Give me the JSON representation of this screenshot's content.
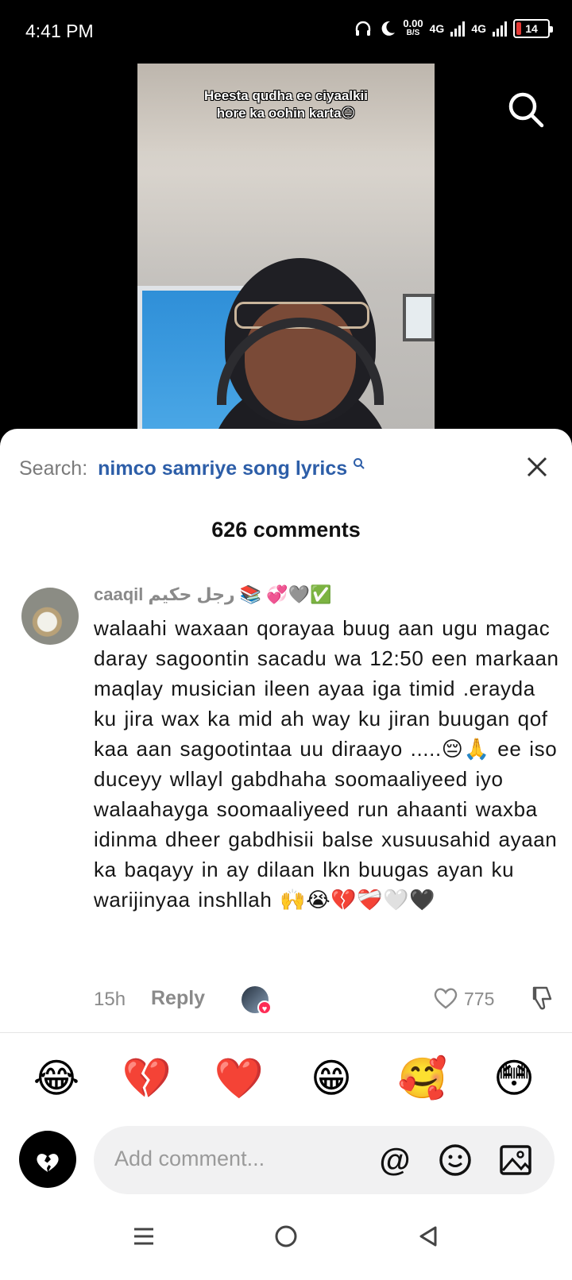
{
  "status_bar": {
    "time": "4:41 PM",
    "net_speed_value": "0.00",
    "net_speed_unit": "B/S",
    "network_1": "4G",
    "network_2": "4G",
    "battery": "14"
  },
  "video": {
    "caption_line1": "Heesta qudha ee ciyaalkii",
    "caption_line2": "hore ka oohin karta😑"
  },
  "comments_panel": {
    "search_label": "Search:",
    "search_query": "nimco samriye song lyrics",
    "count_label": "626 comments"
  },
  "comment": {
    "username": "caaqil  رجل حكيم 📚 💞🩶✅",
    "text": "walaahi waxaan qorayaa buug aan ugu magac daray sagoontin sacadu wa 12:50 een markaan maqlay musician ileen ayaa iga timid .erayda ku jira wax ka mid ah way ku jiran buugan qof kaa aan sagootintaa uu diraayo .....😔🙏 ee iso duceyy wllayl gabdhaha soomaaliyeed iyo walaahayga soomaaliyeed run ahaanti waxba idinma dheer gabdhisii balse xusuusahid ayaan ka baqayy in ay dilaan lkn buugas ayan ku warijinyaa inshllah 🙌😭💔❤️‍🩹🤍🖤",
    "time": "15h",
    "reply_label": "Reply",
    "like_count": "775"
  },
  "quick_emojis": [
    "😂",
    "💔",
    "❤️",
    "😁",
    "🥰",
    "😳"
  ],
  "compose": {
    "placeholder": "Add comment...",
    "mention_symbol": "@"
  },
  "colors": {
    "accent_blue": "#2d5ea8",
    "like_red": "#fe2c55",
    "battery_low": "#e53935"
  },
  "icons": [
    "headphones-icon",
    "moon-icon",
    "signal-icon",
    "battery-icon",
    "search-icon",
    "close-icon",
    "heart-icon",
    "dislike-icon",
    "broken-heart-icon",
    "emoji-icon",
    "image-icon",
    "menu-icon",
    "home-icon",
    "back-icon"
  ]
}
